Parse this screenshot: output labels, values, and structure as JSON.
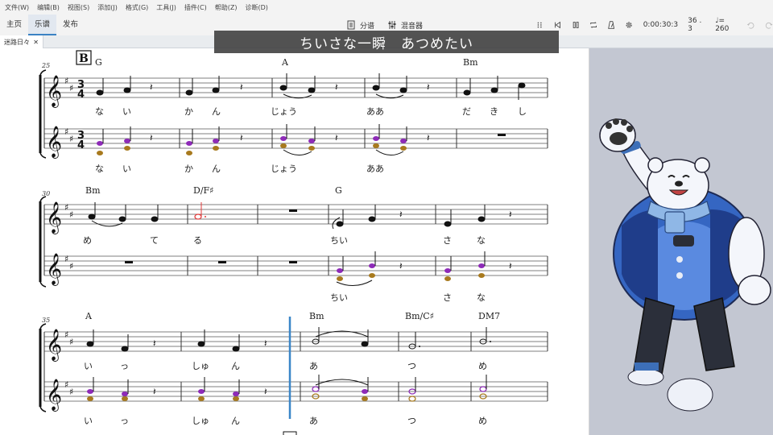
{
  "menu": [
    "文件(W)",
    "编辑(B)",
    "视图(S)",
    "添加(J)",
    "格式(G)",
    "工具(J)",
    "插件(C)",
    "帮助(Z)",
    "诊断(D)"
  ],
  "tabs": [
    "主页",
    "乐谱",
    "发布"
  ],
  "toolbar": {
    "score_label": "分谱",
    "mixer_label": "混音器",
    "time": "0:00:30:3",
    "position": "36 . 3",
    "tempo": "= 260"
  },
  "doc_tab": "迷路日々",
  "subtitle": "ちいさな一瞬　あつめたい",
  "rehearsal_mark": "B",
  "systems": [
    {
      "start_measure": "25",
      "chords": [
        "G",
        "A",
        "Bm"
      ],
      "lyrics_top": [
        "な",
        "い",
        "か",
        "ん",
        "じょう",
        "ああ",
        "だ",
        "き",
        "し"
      ],
      "lyrics_bottom": [
        "な",
        "い",
        "か",
        "ん",
        "じょう",
        "ああ"
      ]
    },
    {
      "start_measure": "30",
      "chords": [
        "Bm",
        "D/F♯",
        "G"
      ],
      "lyrics_top": [
        "め",
        "て",
        "る",
        "ちい",
        "さ",
        "な"
      ],
      "lyrics_bottom": [
        "ちい",
        "さ",
        "な"
      ]
    },
    {
      "start_measure": "35",
      "chords": [
        "A",
        "Bm",
        "Bm/C♯",
        "DM7"
      ],
      "lyrics_top": [
        "い",
        "っ",
        "しゅ",
        "ん",
        "あ",
        "つ",
        "め"
      ],
      "lyrics_bottom": [
        "い",
        "っ",
        "しゅ",
        "ん",
        "あ",
        "つ",
        "め"
      ]
    }
  ],
  "colors": {
    "accent": "#3b82c4",
    "playhead": "#3a86c8",
    "voice_purple": "#8e2bb8",
    "voice_gold": "#a87a1e",
    "selected_red": "#e33b3b"
  }
}
